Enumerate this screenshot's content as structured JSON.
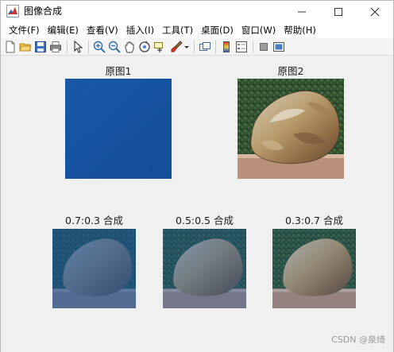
{
  "window": {
    "title": "图像合成",
    "minimize_label": "—",
    "maximize_label": "☐",
    "close_label": "✕"
  },
  "menu": {
    "items": [
      {
        "label": "文件(F)"
      },
      {
        "label": "编辑(E)"
      },
      {
        "label": "查看(V)"
      },
      {
        "label": "插入(I)"
      },
      {
        "label": "工具(T)"
      },
      {
        "label": "桌面(D)"
      },
      {
        "label": "窗口(W)"
      },
      {
        "label": "帮助(H)"
      }
    ]
  },
  "toolbar": {
    "icons": [
      "new-figure-icon",
      "open-file-icon",
      "save-icon",
      "print-icon",
      "pointer-icon",
      "zoom-in-icon",
      "zoom-out-icon",
      "pan-icon",
      "rotate-3d-icon",
      "data-cursor-icon",
      "brush-icon",
      "brush-dropdown-icon",
      "link-plot-icon",
      "colorbar-icon",
      "legend-icon",
      "hide-plot-tools-icon",
      "show-plot-tools-icon"
    ]
  },
  "figure": {
    "titles": {
      "orig1": "原图1",
      "orig2": "原图2",
      "blend1": "0.7:0.3 合成",
      "blend2": "0.5:0.5 合成",
      "blend3": "0.3:0.7 合成"
    },
    "colors": {
      "orig1_blue": "#1553a0",
      "background": "#f0f0f0"
    }
  },
  "watermark": "CSDN @泉绮"
}
